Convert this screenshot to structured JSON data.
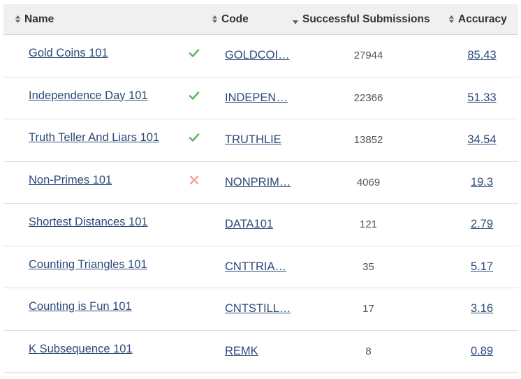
{
  "header": {
    "name": "Name",
    "code": "Code",
    "submissions": "Successful Submissions",
    "accuracy": "Accuracy"
  },
  "colors": {
    "link": "#2d4a7a",
    "check": "#5cb85c",
    "cross": "#f0a0a0",
    "header_bg": "#f0f0f0"
  },
  "rows": [
    {
      "name": "Gold Coins 101",
      "status": "check",
      "code": "GOLDCOI…",
      "submissions": "27944",
      "accuracy": "85.43"
    },
    {
      "name": "Independence Day 101",
      "status": "check",
      "code": "INDEPEN…",
      "submissions": "22366",
      "accuracy": "51.33"
    },
    {
      "name": "Truth Teller And Liars 101",
      "status": "check",
      "code": "TRUTHLIE",
      "submissions": "13852",
      "accuracy": "34.54"
    },
    {
      "name": "Non-Primes 101",
      "status": "cross",
      "code": "NONPRIM…",
      "submissions": "4069",
      "accuracy": "19.3"
    },
    {
      "name": "Shortest Distances 101",
      "status": "none",
      "code": "DATA101",
      "submissions": "121",
      "accuracy": "2.79"
    },
    {
      "name": "Counting Triangles 101",
      "status": "none",
      "code": "CNTTRIA…",
      "submissions": "35",
      "accuracy": "5.17"
    },
    {
      "name": "Counting is Fun 101",
      "status": "none",
      "code": "CNTSTILL…",
      "submissions": "17",
      "accuracy": "3.16"
    },
    {
      "name": "K Subsequence 101",
      "status": "none",
      "code": "REMK",
      "submissions": "8",
      "accuracy": "0.89"
    }
  ]
}
